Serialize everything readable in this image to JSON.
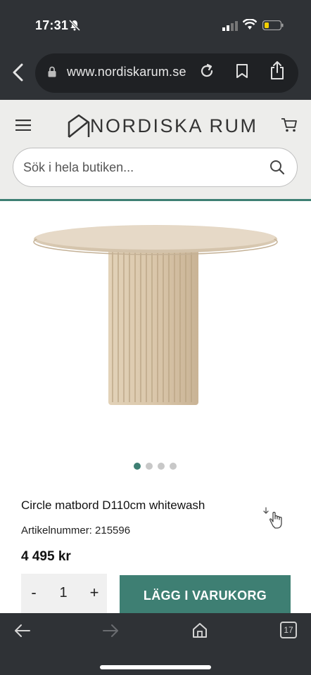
{
  "status": {
    "time": "17:31"
  },
  "browser": {
    "url": "www.nordiskarum.se",
    "tab_count": "17"
  },
  "header": {
    "logo": "NORDISKA RUM",
    "search_placeholder": "Sök i hela butiken..."
  },
  "gallery": {
    "slide_count": 4,
    "active_index": 0
  },
  "product": {
    "title": "Circle matbord D110cm whitewash",
    "sku": "Artikelnummer: 215596",
    "price": "4 495 kr",
    "quantity": "1",
    "minus_label": "-",
    "plus_label": "+",
    "add_to_cart": "LÄGG I VARUKORG"
  },
  "colors": {
    "brand_green": "#3e7f73",
    "chrome": "#2f3236"
  }
}
